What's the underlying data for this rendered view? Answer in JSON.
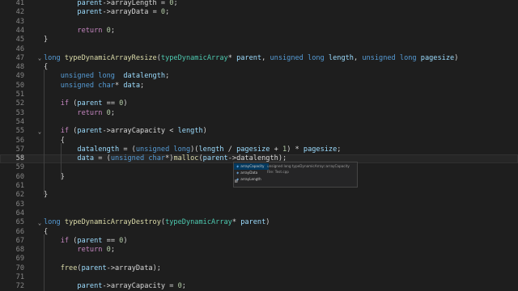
{
  "editor": {
    "lines": [
      {
        "n": "41",
        "fold": "",
        "current": false,
        "tokens": [
          [
            "",
            "        "
          ],
          [
            "pm",
            "parent"
          ],
          [
            "",
            "->"
          ],
          [
            "fd",
            "arrayLength"
          ],
          [
            "",
            " = "
          ],
          [
            "num",
            "0"
          ],
          [
            "",
            ";"
          ]
        ]
      },
      {
        "n": "42",
        "fold": "",
        "current": false,
        "tokens": [
          [
            "",
            "        "
          ],
          [
            "pm",
            "parent"
          ],
          [
            "",
            "->"
          ],
          [
            "fd",
            "arrayData"
          ],
          [
            "",
            " = "
          ],
          [
            "num",
            "0"
          ],
          [
            "",
            ";"
          ]
        ]
      },
      {
        "n": "43",
        "fold": "",
        "current": false,
        "tokens": []
      },
      {
        "n": "44",
        "fold": "",
        "current": false,
        "tokens": [
          [
            "",
            "        "
          ],
          [
            "ctl",
            "return"
          ],
          [
            "",
            " "
          ],
          [
            "num",
            "0"
          ],
          [
            "",
            ";"
          ]
        ]
      },
      {
        "n": "45",
        "fold": "",
        "current": false,
        "tokens": [
          [
            "",
            "}"
          ]
        ]
      },
      {
        "n": "46",
        "fold": "",
        "current": false,
        "tokens": []
      },
      {
        "n": "47",
        "fold": "⌄",
        "current": false,
        "tokens": [
          [
            "kw",
            "long"
          ],
          [
            "",
            " "
          ],
          [
            "fn",
            "typeDynamicArrayResize"
          ],
          [
            "",
            "("
          ],
          [
            "ty",
            "typeDynamicArray"
          ],
          [
            "",
            "* "
          ],
          [
            "pm",
            "parent"
          ],
          [
            "",
            ", "
          ],
          [
            "kw",
            "unsigned long"
          ],
          [
            "",
            " "
          ],
          [
            "pm",
            "length"
          ],
          [
            "",
            ", "
          ],
          [
            "kw",
            "unsigned long"
          ],
          [
            "",
            " "
          ],
          [
            "pm",
            "pagesize"
          ],
          [
            "",
            ")"
          ]
        ]
      },
      {
        "n": "48",
        "fold": "",
        "current": false,
        "tokens": [
          [
            "",
            "{"
          ]
        ]
      },
      {
        "n": "49",
        "fold": "",
        "current": false,
        "tokens": [
          [
            "",
            "    "
          ],
          [
            "kw",
            "unsigned long"
          ],
          [
            "",
            "  "
          ],
          [
            "pm",
            "datalength"
          ],
          [
            "",
            ";"
          ]
        ]
      },
      {
        "n": "50",
        "fold": "",
        "current": false,
        "tokens": [
          [
            "",
            "    "
          ],
          [
            "kw",
            "unsigned char"
          ],
          [
            "",
            "* "
          ],
          [
            "pm",
            "data"
          ],
          [
            "",
            ";"
          ]
        ]
      },
      {
        "n": "51",
        "fold": "",
        "current": false,
        "tokens": []
      },
      {
        "n": "52",
        "fold": "",
        "current": false,
        "tokens": [
          [
            "",
            "    "
          ],
          [
            "ctl",
            "if"
          ],
          [
            "",
            " ("
          ],
          [
            "pm",
            "parent"
          ],
          [
            "",
            " == "
          ],
          [
            "num",
            "0"
          ],
          [
            "",
            ")"
          ]
        ]
      },
      {
        "n": "53",
        "fold": "",
        "current": false,
        "tokens": [
          [
            "",
            "        "
          ],
          [
            "ctl",
            "return"
          ],
          [
            "",
            " "
          ],
          [
            "num",
            "0"
          ],
          [
            "",
            ";"
          ]
        ]
      },
      {
        "n": "54",
        "fold": "",
        "current": false,
        "tokens": []
      },
      {
        "n": "55",
        "fold": "⌄",
        "current": false,
        "tokens": [
          [
            "",
            "    "
          ],
          [
            "ctl",
            "if"
          ],
          [
            "",
            " ("
          ],
          [
            "pm",
            "parent"
          ],
          [
            "",
            "->"
          ],
          [
            "fd",
            "arrayCapacity"
          ],
          [
            "",
            " < "
          ],
          [
            "pm",
            "length"
          ],
          [
            "",
            ")"
          ]
        ]
      },
      {
        "n": "56",
        "fold": "",
        "current": false,
        "tokens": [
          [
            "",
            "    {"
          ]
        ]
      },
      {
        "n": "57",
        "fold": "",
        "current": false,
        "tokens": [
          [
            "",
            "        "
          ],
          [
            "pm",
            "datalength"
          ],
          [
            "",
            " = ("
          ],
          [
            "kw",
            "unsigned long"
          ],
          [
            "",
            ")("
          ],
          [
            "pm",
            "length"
          ],
          [
            "",
            " / "
          ],
          [
            "pm",
            "pagesize"
          ],
          [
            "",
            " + "
          ],
          [
            "num",
            "1"
          ],
          [
            "",
            ") * "
          ],
          [
            "pm",
            "pagesize"
          ],
          [
            "",
            ";"
          ]
        ]
      },
      {
        "n": "58",
        "fold": "",
        "current": true,
        "tokens": [
          [
            "",
            "        "
          ],
          [
            "pm",
            "data"
          ],
          [
            "",
            " = ("
          ],
          [
            "kw",
            "unsigned char"
          ],
          [
            "",
            "*)"
          ],
          [
            "fn",
            "malloc"
          ],
          [
            "",
            "("
          ],
          [
            "pm",
            "parent"
          ],
          [
            "",
            "->"
          ],
          [
            "fd",
            "datalength"
          ],
          [
            "",
            ");"
          ]
        ]
      },
      {
        "n": "59",
        "fold": "",
        "current": false,
        "tokens": []
      },
      {
        "n": "60",
        "fold": "",
        "current": false,
        "tokens": [
          [
            "",
            "    }"
          ]
        ]
      },
      {
        "n": "61",
        "fold": "",
        "current": false,
        "tokens": []
      },
      {
        "n": "62",
        "fold": "",
        "current": false,
        "tokens": [
          [
            "",
            "}"
          ]
        ]
      },
      {
        "n": "63",
        "fold": "",
        "current": false,
        "tokens": []
      },
      {
        "n": "64",
        "fold": "",
        "current": false,
        "tokens": []
      },
      {
        "n": "65",
        "fold": "⌄",
        "current": false,
        "tokens": [
          [
            "kw",
            "long"
          ],
          [
            "",
            " "
          ],
          [
            "fn",
            "typeDynamicArrayDestroy"
          ],
          [
            "",
            "("
          ],
          [
            "ty",
            "typeDynamicArray"
          ],
          [
            "",
            "* "
          ],
          [
            "pm",
            "parent"
          ],
          [
            "",
            ")"
          ]
        ]
      },
      {
        "n": "66",
        "fold": "",
        "current": false,
        "tokens": [
          [
            "",
            "{"
          ]
        ]
      },
      {
        "n": "67",
        "fold": "",
        "current": false,
        "tokens": [
          [
            "",
            "    "
          ],
          [
            "ctl",
            "if"
          ],
          [
            "",
            " ("
          ],
          [
            "pm",
            "parent"
          ],
          [
            "",
            " == "
          ],
          [
            "num",
            "0"
          ],
          [
            "",
            ")"
          ]
        ]
      },
      {
        "n": "68",
        "fold": "",
        "current": false,
        "tokens": [
          [
            "",
            "        "
          ],
          [
            "ctl",
            "return"
          ],
          [
            "",
            " "
          ],
          [
            "num",
            "0"
          ],
          [
            "",
            ";"
          ]
        ]
      },
      {
        "n": "69",
        "fold": "",
        "current": false,
        "tokens": []
      },
      {
        "n": "70",
        "fold": "",
        "current": false,
        "tokens": [
          [
            "",
            "    "
          ],
          [
            "fn",
            "free"
          ],
          [
            "",
            "("
          ],
          [
            "pm",
            "parent"
          ],
          [
            "",
            "->"
          ],
          [
            "fd",
            "arrayData"
          ],
          [
            "",
            ");"
          ]
        ]
      },
      {
        "n": "71",
        "fold": "",
        "current": false,
        "tokens": []
      },
      {
        "n": "72",
        "fold": "",
        "current": false,
        "tokens": [
          [
            "",
            "        "
          ],
          [
            "pm",
            "parent"
          ],
          [
            "",
            "->"
          ],
          [
            "fd",
            "arrayCapacity"
          ],
          [
            "",
            " = "
          ],
          [
            "num",
            "0"
          ],
          [
            "",
            ";"
          ]
        ]
      }
    ]
  },
  "suggest": {
    "items": [
      {
        "label": "arrayCapacity",
        "icon": "field-icon",
        "selected": true
      },
      {
        "label": "arrayData",
        "icon": "field-icon",
        "selected": false
      },
      {
        "label": "arrayLength",
        "icon": "field-icon",
        "selected": false
      }
    ],
    "detail_line1": "unsigned long typeDynamicArray::arrayCapacity",
    "detail_line2": "File: Test.cpp",
    "close_glyph": "⊠"
  },
  "colors": {
    "background": "#1e1e1e",
    "keyword": "#569cd6",
    "control": "#c586c0",
    "type": "#4ec9b0",
    "function": "#dcdcaa",
    "number": "#b5cea8",
    "variable": "#9cdcfe"
  }
}
